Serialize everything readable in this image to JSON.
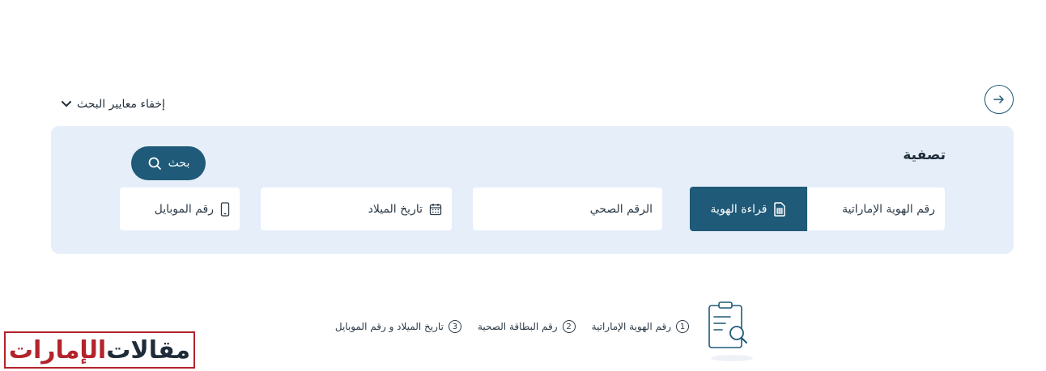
{
  "nav": {
    "back_icon": "arrow-right-icon"
  },
  "search_toggle": {
    "label": "إخفاء معايير البحث",
    "icon": "chevron-down-icon"
  },
  "filter": {
    "title": "تصفية",
    "search_button": {
      "label": "بحث",
      "icon": "search-icon"
    },
    "emirates_id": {
      "placeholder": "رقم الهوية الإماراتية"
    },
    "read_id_button": {
      "label": "قراءة الهوية",
      "icon": "sim-card-icon"
    },
    "health_number": {
      "placeholder": "الرقم الصحي"
    },
    "dob": {
      "placeholder": "تاريخ الميلاد",
      "icon": "calendar-icon"
    },
    "mobile": {
      "placeholder": "رقم الموبايل",
      "icon": "mobile-phone-icon"
    }
  },
  "steps": [
    {
      "num": "1",
      "label": "رقم الهوية الإماراتية"
    },
    {
      "num": "2",
      "label": "رقم البطاقة الصحية"
    },
    {
      "num": "3",
      "label": "تاريخ الميلاد و رقم الموبايل"
    }
  ],
  "watermark": {
    "part1": "مقالات",
    "part2": "الإمارات"
  },
  "colors": {
    "primary": "#1f5a78",
    "panel_bg": "#e6eefa",
    "watermark_red": "#b3232b"
  }
}
